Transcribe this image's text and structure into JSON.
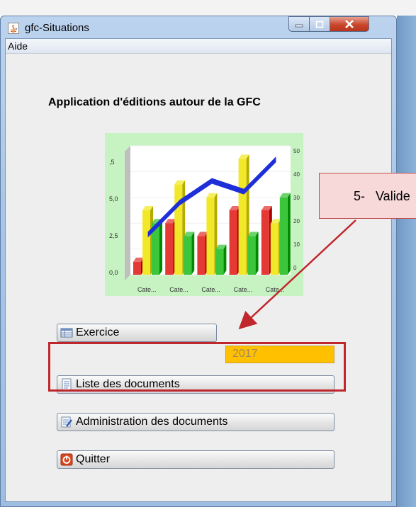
{
  "window": {
    "title": "gfc-Situations"
  },
  "menu": {
    "aide": "Aide"
  },
  "main": {
    "app_title": "Application d'éditions autour de la GFC",
    "buttons": {
      "exercice": "Exercice",
      "liste": "Liste des documents",
      "admin": "Administration des documents",
      "quitter": "Quitter"
    },
    "year_value": "2017"
  },
  "callout": {
    "text": "5-   Valide"
  },
  "chart_data": {
    "type": "bar",
    "categories": [
      "Cate...",
      "Cate...",
      "Cate...",
      "Cate...",
      "Cate..."
    ],
    "left_ticks": [
      ",5",
      "5,0",
      "2,5",
      "0,0"
    ],
    "right_ticks": [
      "50",
      "40",
      "30",
      "20",
      "10",
      "0"
    ],
    "series": [
      {
        "values": [
          1,
          4,
          3,
          5,
          5
        ],
        "color": "#e53935"
      },
      {
        "values": [
          5,
          7,
          6,
          9,
          4
        ],
        "color": "#f2e82a"
      },
      {
        "values": [
          4,
          3,
          2,
          3,
          6
        ],
        "color": "#3bc63b"
      }
    ],
    "line_values": [
      4,
      7,
      9,
      8,
      11
    ],
    "line_color": "#1e2ed8"
  }
}
